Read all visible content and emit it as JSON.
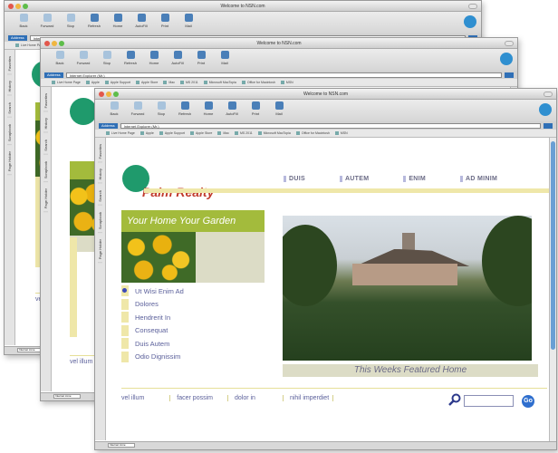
{
  "browser": {
    "window_title": "Welcome to NSN.com",
    "toolbar": [
      {
        "label": "Back",
        "icon": "back-arrow-icon"
      },
      {
        "label": "Forward",
        "icon": "forward-arrow-icon"
      },
      {
        "label": "Stop",
        "icon": "stop-icon"
      },
      {
        "label": "Refresh",
        "icon": "refresh-icon"
      },
      {
        "label": "Home",
        "icon": "home-icon"
      },
      {
        "label": "AutoFill",
        "icon": "autofill-icon"
      },
      {
        "label": "Print",
        "icon": "print-icon"
      },
      {
        "label": "Mail",
        "icon": "mail-icon"
      }
    ],
    "address_label": "Address",
    "address_value": "Internet Explorer (Mr.)",
    "favorites": [
      "Live Home Page",
      "Apple",
      "Apple Support",
      "Apple Store",
      "Mac",
      "MS 2011",
      "Microsoft MacTopia",
      "Office for Macintosh",
      "MSN"
    ],
    "side_tabs": [
      "Favorites",
      "History",
      "Search",
      "Scrapbook",
      "Page Holder"
    ],
    "status_zone": "Internet zone"
  },
  "site": {
    "logo_text": "Palm Realty",
    "nav": [
      "DUIS",
      "AUTEM",
      "ENIM",
      "AD MINIM"
    ],
    "tagline": "Your Home Your Garden",
    "menu": [
      "Ut Wisi Enim Ad",
      "Dolores",
      "Hendrerit In",
      "Consequat",
      "Duis Autem",
      "Odio Dignissim"
    ],
    "featured_caption": "This Weeks Featured Home",
    "footer_links": [
      "vel illum",
      "facer possim",
      "dolor in",
      "nihil imperdiet"
    ],
    "search_placeholder": "",
    "go_label": "Go"
  },
  "colors": {
    "brand_green": "#a3bb3c",
    "logo_red": "#c0392b",
    "accent_yellow": "#efe7a9",
    "link_blue": "#5a5f9a",
    "go_blue": "#2f6fce"
  }
}
